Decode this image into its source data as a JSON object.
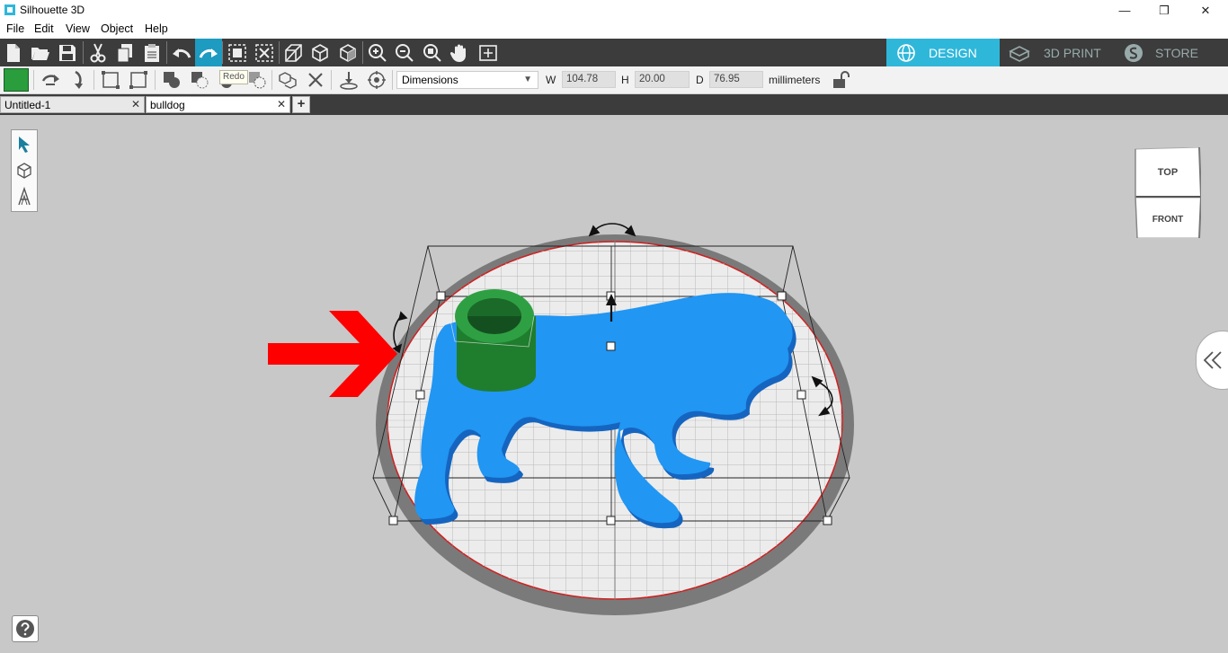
{
  "window": {
    "title": "Silhouette 3D",
    "controls": {
      "minimize": "—",
      "restore": "❐",
      "close": "✕"
    }
  },
  "menu": {
    "items": [
      "File",
      "Edit",
      "View",
      "Object",
      "Help"
    ]
  },
  "mode_tabs": [
    {
      "label": "DESIGN",
      "icon": "globe-icon",
      "active": true
    },
    {
      "label": "3D PRINT",
      "icon": "printer-icon",
      "active": false
    },
    {
      "label": "STORE",
      "icon": "store-s-icon",
      "active": false
    }
  ],
  "tooltip": "Redo",
  "dimensions": {
    "mode": "Dimensions",
    "w_label": "W",
    "w_value": "104.78",
    "h_label": "H",
    "h_value": "20.00",
    "d_label": "D",
    "d_value": "76.95",
    "unit": "millimeters"
  },
  "doc_tabs": [
    {
      "label": "Untitled-1",
      "active": false
    },
    {
      "label": "bulldog",
      "active": true
    }
  ],
  "view_cube": {
    "top": "TOP",
    "front": "FRONT"
  },
  "colors": {
    "accent": "#2fb7da",
    "toolbar_dark": "#3c3c3c",
    "model_blue": "#2196f3",
    "model_green": "#2a9d3d",
    "arrow_red": "#ff0000"
  }
}
